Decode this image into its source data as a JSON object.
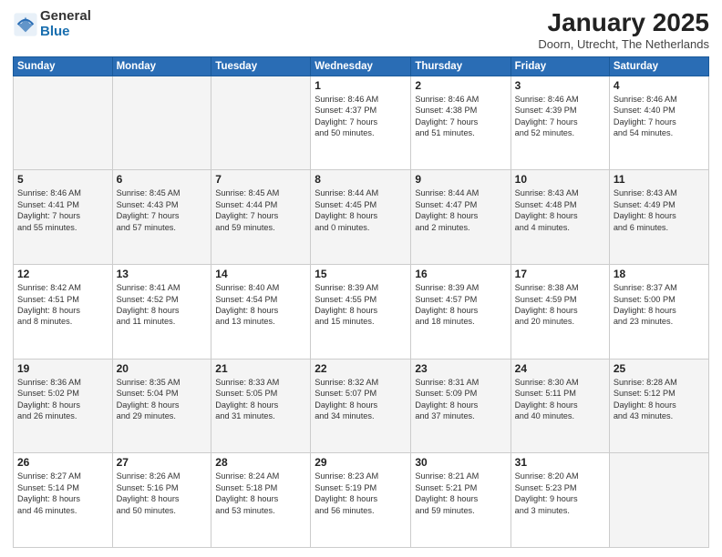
{
  "header": {
    "logo_general": "General",
    "logo_blue": "Blue",
    "month_title": "January 2025",
    "location": "Doorn, Utrecht, The Netherlands"
  },
  "days_of_week": [
    "Sunday",
    "Monday",
    "Tuesday",
    "Wednesday",
    "Thursday",
    "Friday",
    "Saturday"
  ],
  "weeks": [
    [
      {
        "day": "",
        "info": ""
      },
      {
        "day": "",
        "info": ""
      },
      {
        "day": "",
        "info": ""
      },
      {
        "day": "1",
        "info": "Sunrise: 8:46 AM\nSunset: 4:37 PM\nDaylight: 7 hours\nand 50 minutes."
      },
      {
        "day": "2",
        "info": "Sunrise: 8:46 AM\nSunset: 4:38 PM\nDaylight: 7 hours\nand 51 minutes."
      },
      {
        "day": "3",
        "info": "Sunrise: 8:46 AM\nSunset: 4:39 PM\nDaylight: 7 hours\nand 52 minutes."
      },
      {
        "day": "4",
        "info": "Sunrise: 8:46 AM\nSunset: 4:40 PM\nDaylight: 7 hours\nand 54 minutes."
      }
    ],
    [
      {
        "day": "5",
        "info": "Sunrise: 8:46 AM\nSunset: 4:41 PM\nDaylight: 7 hours\nand 55 minutes."
      },
      {
        "day": "6",
        "info": "Sunrise: 8:45 AM\nSunset: 4:43 PM\nDaylight: 7 hours\nand 57 minutes."
      },
      {
        "day": "7",
        "info": "Sunrise: 8:45 AM\nSunset: 4:44 PM\nDaylight: 7 hours\nand 59 minutes."
      },
      {
        "day": "8",
        "info": "Sunrise: 8:44 AM\nSunset: 4:45 PM\nDaylight: 8 hours\nand 0 minutes."
      },
      {
        "day": "9",
        "info": "Sunrise: 8:44 AM\nSunset: 4:47 PM\nDaylight: 8 hours\nand 2 minutes."
      },
      {
        "day": "10",
        "info": "Sunrise: 8:43 AM\nSunset: 4:48 PM\nDaylight: 8 hours\nand 4 minutes."
      },
      {
        "day": "11",
        "info": "Sunrise: 8:43 AM\nSunset: 4:49 PM\nDaylight: 8 hours\nand 6 minutes."
      }
    ],
    [
      {
        "day": "12",
        "info": "Sunrise: 8:42 AM\nSunset: 4:51 PM\nDaylight: 8 hours\nand 8 minutes."
      },
      {
        "day": "13",
        "info": "Sunrise: 8:41 AM\nSunset: 4:52 PM\nDaylight: 8 hours\nand 11 minutes."
      },
      {
        "day": "14",
        "info": "Sunrise: 8:40 AM\nSunset: 4:54 PM\nDaylight: 8 hours\nand 13 minutes."
      },
      {
        "day": "15",
        "info": "Sunrise: 8:39 AM\nSunset: 4:55 PM\nDaylight: 8 hours\nand 15 minutes."
      },
      {
        "day": "16",
        "info": "Sunrise: 8:39 AM\nSunset: 4:57 PM\nDaylight: 8 hours\nand 18 minutes."
      },
      {
        "day": "17",
        "info": "Sunrise: 8:38 AM\nSunset: 4:59 PM\nDaylight: 8 hours\nand 20 minutes."
      },
      {
        "day": "18",
        "info": "Sunrise: 8:37 AM\nSunset: 5:00 PM\nDaylight: 8 hours\nand 23 minutes."
      }
    ],
    [
      {
        "day": "19",
        "info": "Sunrise: 8:36 AM\nSunset: 5:02 PM\nDaylight: 8 hours\nand 26 minutes."
      },
      {
        "day": "20",
        "info": "Sunrise: 8:35 AM\nSunset: 5:04 PM\nDaylight: 8 hours\nand 29 minutes."
      },
      {
        "day": "21",
        "info": "Sunrise: 8:33 AM\nSunset: 5:05 PM\nDaylight: 8 hours\nand 31 minutes."
      },
      {
        "day": "22",
        "info": "Sunrise: 8:32 AM\nSunset: 5:07 PM\nDaylight: 8 hours\nand 34 minutes."
      },
      {
        "day": "23",
        "info": "Sunrise: 8:31 AM\nSunset: 5:09 PM\nDaylight: 8 hours\nand 37 minutes."
      },
      {
        "day": "24",
        "info": "Sunrise: 8:30 AM\nSunset: 5:11 PM\nDaylight: 8 hours\nand 40 minutes."
      },
      {
        "day": "25",
        "info": "Sunrise: 8:28 AM\nSunset: 5:12 PM\nDaylight: 8 hours\nand 43 minutes."
      }
    ],
    [
      {
        "day": "26",
        "info": "Sunrise: 8:27 AM\nSunset: 5:14 PM\nDaylight: 8 hours\nand 46 minutes."
      },
      {
        "day": "27",
        "info": "Sunrise: 8:26 AM\nSunset: 5:16 PM\nDaylight: 8 hours\nand 50 minutes."
      },
      {
        "day": "28",
        "info": "Sunrise: 8:24 AM\nSunset: 5:18 PM\nDaylight: 8 hours\nand 53 minutes."
      },
      {
        "day": "29",
        "info": "Sunrise: 8:23 AM\nSunset: 5:19 PM\nDaylight: 8 hours\nand 56 minutes."
      },
      {
        "day": "30",
        "info": "Sunrise: 8:21 AM\nSunset: 5:21 PM\nDaylight: 8 hours\nand 59 minutes."
      },
      {
        "day": "31",
        "info": "Sunrise: 8:20 AM\nSunset: 5:23 PM\nDaylight: 9 hours\nand 3 minutes."
      },
      {
        "day": "",
        "info": ""
      }
    ]
  ]
}
